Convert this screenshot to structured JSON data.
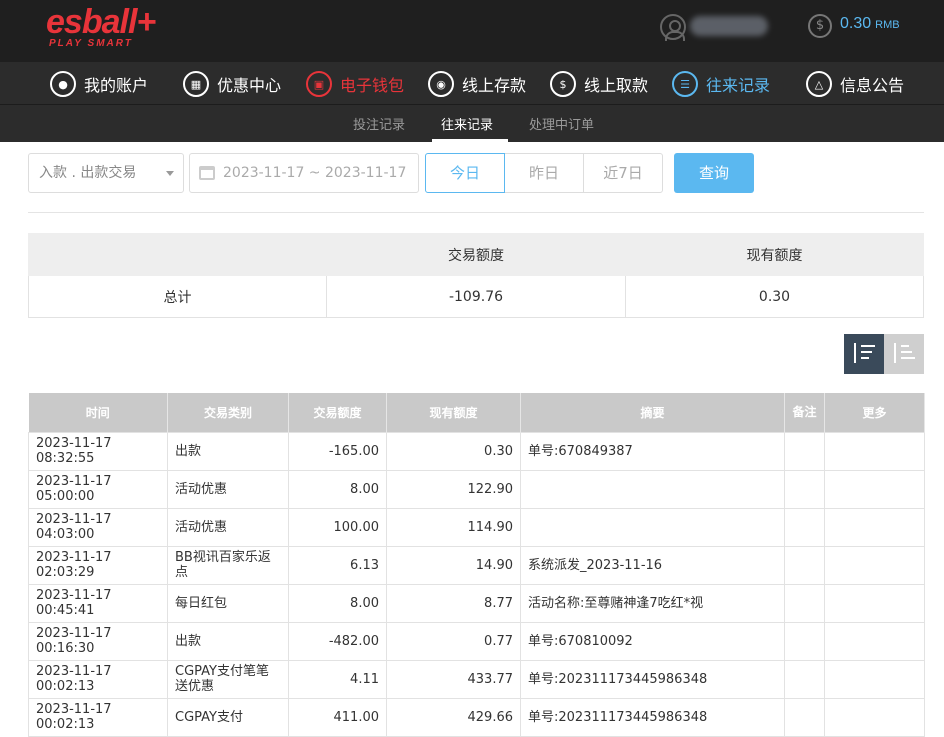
{
  "header": {
    "logo_text": "esball+",
    "logo_tagline": "PLAY SMART",
    "balance": "0.30",
    "currency": "RMB"
  },
  "nav": [
    {
      "label": "我的账户",
      "icon": "user-icon"
    },
    {
      "label": "优惠中心",
      "icon": "gift-icon"
    },
    {
      "label": "电子钱包",
      "icon": "wallet-icon"
    },
    {
      "label": "线上存款",
      "icon": "deposit-icon"
    },
    {
      "label": "线上取款",
      "icon": "withdraw-icon"
    },
    {
      "label": "往来记录",
      "icon": "records-icon"
    },
    {
      "label": "信息公告",
      "icon": "bell-icon"
    }
  ],
  "subnav": [
    "投注记录",
    "往来记录",
    "处理中订单"
  ],
  "filters": {
    "type_select": "入款 . 出款交易",
    "date_range": "2023-11-17 ~ 2023-11-17",
    "range_buttons": [
      "今日",
      "昨日",
      "近7日"
    ],
    "query_label": "查询"
  },
  "summary": {
    "headers": [
      "",
      "交易额度",
      "现有额度"
    ],
    "row": [
      "总计",
      "-109.76",
      "0.30"
    ]
  },
  "records": {
    "headers": [
      "时间",
      "交易类别",
      "交易额度",
      "现有额度",
      "摘要",
      "备注",
      "更多"
    ],
    "rows": [
      [
        "2023-11-17 08:32:55",
        "出款",
        "-165.00",
        "0.30",
        "单号:670849387",
        "",
        ""
      ],
      [
        "2023-11-17 05:00:00",
        "活动优惠",
        "8.00",
        "122.90",
        "",
        "",
        ""
      ],
      [
        "2023-11-17 04:03:00",
        "活动优惠",
        "100.00",
        "114.90",
        "",
        "",
        ""
      ],
      [
        "2023-11-17 02:03:29",
        "BB视讯百家乐返点",
        "6.13",
        "14.90",
        "系统派发_2023-11-16",
        "",
        ""
      ],
      [
        "2023-11-17 00:45:41",
        "每日红包",
        "8.00",
        "8.77",
        "活动名称:至尊赌神逢7吃红*视",
        "",
        ""
      ],
      [
        "2023-11-17 00:16:30",
        "出款",
        "-482.00",
        "0.77",
        "单号:670810092",
        "",
        ""
      ],
      [
        "2023-11-17 00:02:13",
        "CGPAY支付笔笔送优惠",
        "4.11",
        "433.77",
        "单号:202311173445986348",
        "",
        ""
      ],
      [
        "2023-11-17 00:02:13",
        "CGPAY支付",
        "411.00",
        "429.66",
        "单号:202311173445986348",
        "",
        ""
      ]
    ]
  }
}
